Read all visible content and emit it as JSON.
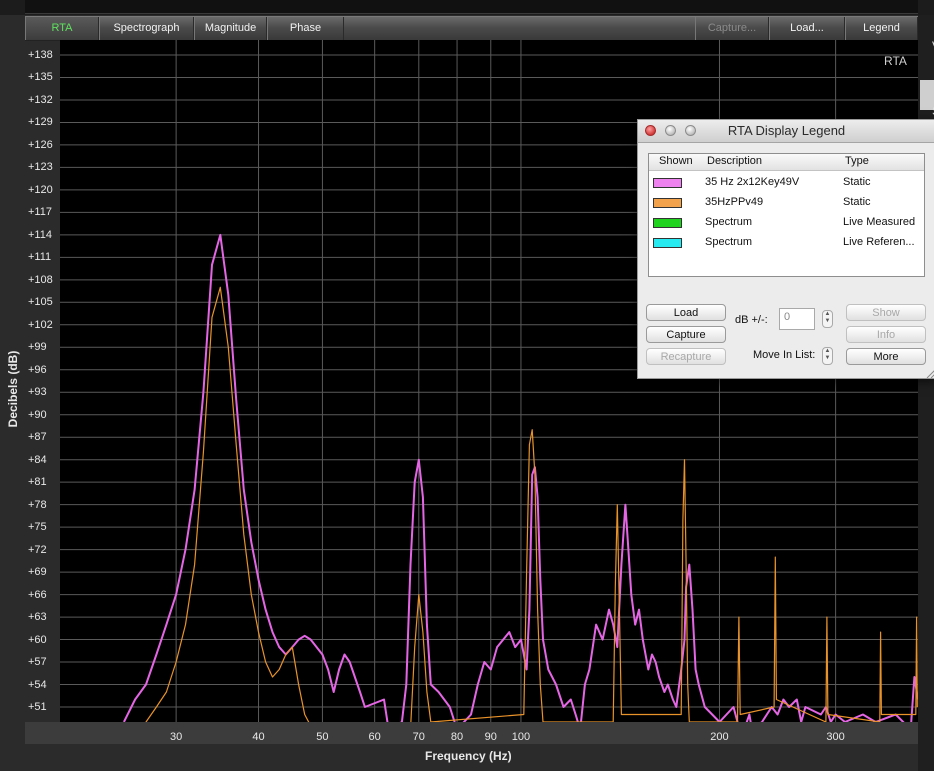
{
  "tabs": [
    {
      "label": "RTA",
      "active": true
    },
    {
      "label": "Spectrograph"
    },
    {
      "label": "Magnitude"
    },
    {
      "label": "Phase"
    },
    {
      "label": "Capture...",
      "disabled": true
    },
    {
      "label": "Load..."
    },
    {
      "label": "Legend"
    }
  ],
  "plot": {
    "name": "RTA",
    "xlabel": "Frequency (Hz)",
    "ylabel": "Decibels (dB)"
  },
  "chart_data": {
    "type": "line",
    "xlabel": "Frequency (Hz)",
    "ylabel": "Decibels (dB)",
    "xscale": "log",
    "xlim": [
      20,
      400
    ],
    "ylim": [
      49,
      140
    ],
    "grid": true,
    "x_ticks": [
      "30",
      "40",
      "50",
      "60",
      "70",
      "80",
      "90",
      "100",
      "200",
      "300"
    ],
    "y_ticks": [
      "+138",
      "+135",
      "+132",
      "+129",
      "+126",
      "+123",
      "+120",
      "+117",
      "+114",
      "+111",
      "+108",
      "+105",
      "+102",
      "+99",
      "+96",
      "+93",
      "+90",
      "+87",
      "+84",
      "+81",
      "+78",
      "+75",
      "+72",
      "+69",
      "+66",
      "+63",
      "+60",
      "+57",
      "+54",
      "+51"
    ],
    "series": [
      {
        "name": "35 Hz 2x12Key49V",
        "color": "#e566e5",
        "points": [
          [
            25,
            49
          ],
          [
            26,
            52
          ],
          [
            27,
            54
          ],
          [
            28,
            58
          ],
          [
            29,
            62
          ],
          [
            30,
            66
          ],
          [
            31,
            72
          ],
          [
            32,
            80
          ],
          [
            33,
            93
          ],
          [
            34,
            110
          ],
          [
            35,
            114
          ],
          [
            36,
            106
          ],
          [
            37,
            92
          ],
          [
            38,
            80
          ],
          [
            39,
            73
          ],
          [
            40,
            68
          ],
          [
            41,
            64
          ],
          [
            42,
            61
          ],
          [
            43,
            59
          ],
          [
            44,
            58
          ],
          [
            45,
            59
          ],
          [
            46,
            60
          ],
          [
            47,
            60.5
          ],
          [
            48,
            60
          ],
          [
            50,
            58
          ],
          [
            51,
            56
          ],
          [
            52,
            53
          ],
          [
            53,
            56
          ],
          [
            54,
            58
          ],
          [
            55,
            57
          ],
          [
            57,
            53
          ],
          [
            58,
            51
          ],
          [
            62,
            52
          ],
          [
            63,
            48
          ],
          [
            66,
            49
          ],
          [
            67,
            54
          ],
          [
            68,
            70
          ],
          [
            69,
            81
          ],
          [
            70,
            84
          ],
          [
            71,
            79
          ],
          [
            72,
            62
          ],
          [
            73,
            54
          ],
          [
            75,
            53
          ],
          [
            78,
            51
          ],
          [
            80,
            48
          ],
          [
            84,
            50
          ],
          [
            86,
            54
          ],
          [
            88,
            57
          ],
          [
            90,
            56
          ],
          [
            92,
            59
          ],
          [
            94,
            60
          ],
          [
            96,
            61
          ],
          [
            98,
            59
          ],
          [
            100,
            60
          ],
          [
            101,
            58
          ],
          [
            102,
            56
          ],
          [
            103,
            64
          ],
          [
            104,
            82
          ],
          [
            105,
            83
          ],
          [
            106,
            79
          ],
          [
            107,
            68
          ],
          [
            108,
            60
          ],
          [
            110,
            56
          ],
          [
            113,
            54
          ],
          [
            116,
            51
          ],
          [
            119,
            52
          ],
          [
            121,
            50
          ],
          [
            123,
            48
          ],
          [
            125,
            54
          ],
          [
            127,
            56
          ],
          [
            130,
            62
          ],
          [
            133,
            60
          ],
          [
            136,
            64
          ],
          [
            138,
            62
          ],
          [
            140,
            59
          ],
          [
            142,
            70
          ],
          [
            144,
            78
          ],
          [
            145,
            74
          ],
          [
            147,
            66
          ],
          [
            149,
            62
          ],
          [
            151,
            64
          ],
          [
            153,
            60
          ],
          [
            156,
            56
          ],
          [
            158,
            58
          ],
          [
            160,
            57
          ],
          [
            162,
            55
          ],
          [
            165,
            53
          ],
          [
            167,
            54
          ],
          [
            170,
            52
          ],
          [
            172,
            51
          ],
          [
            175,
            56
          ],
          [
            177,
            60
          ],
          [
            178,
            67
          ],
          [
            180,
            70
          ],
          [
            182,
            64
          ],
          [
            184,
            56
          ],
          [
            186,
            54
          ],
          [
            190,
            51
          ],
          [
            195,
            50
          ],
          [
            200,
            49
          ],
          [
            210,
            51
          ],
          [
            213,
            49
          ],
          [
            216,
            47
          ],
          [
            222,
            50
          ],
          [
            224,
            48
          ],
          [
            232,
            49
          ],
          [
            240,
            51
          ],
          [
            245,
            50
          ],
          [
            250,
            52
          ],
          [
            255,
            51
          ],
          [
            262,
            52
          ],
          [
            266,
            49
          ],
          [
            270,
            51
          ],
          [
            285,
            50
          ],
          [
            290,
            51
          ],
          [
            295,
            49
          ],
          [
            300,
            50
          ],
          [
            310,
            49
          ],
          [
            330,
            50
          ],
          [
            345,
            49
          ],
          [
            370,
            50
          ],
          [
            390,
            48
          ],
          [
            395,
            55
          ],
          [
            400,
            52
          ]
        ]
      },
      {
        "name": "35HzPPv49",
        "color": "#e8922a",
        "points": [
          [
            25,
            45
          ],
          [
            27,
            49
          ],
          [
            28,
            51
          ],
          [
            29,
            53
          ],
          [
            30,
            57
          ],
          [
            31,
            62
          ],
          [
            32,
            70
          ],
          [
            33,
            85
          ],
          [
            34,
            103
          ],
          [
            35,
            107
          ],
          [
            36,
            99
          ],
          [
            37,
            86
          ],
          [
            38,
            74
          ],
          [
            39,
            66
          ],
          [
            40,
            61
          ],
          [
            41,
            57
          ],
          [
            42,
            55
          ],
          [
            43,
            56
          ],
          [
            44,
            58
          ],
          [
            45,
            59
          ],
          [
            46,
            54
          ],
          [
            47,
            50
          ],
          [
            49,
            47
          ],
          [
            68,
            48
          ],
          [
            69,
            59
          ],
          [
            70,
            66
          ],
          [
            71,
            61
          ],
          [
            72,
            53
          ],
          [
            73,
            49
          ],
          [
            101,
            50
          ],
          [
            102,
            69
          ],
          [
            103,
            86
          ],
          [
            104,
            88
          ],
          [
            105,
            82
          ],
          [
            106,
            64
          ],
          [
            107,
            54
          ],
          [
            108,
            49
          ],
          [
            138,
            49
          ],
          [
            139,
            67
          ],
          [
            140,
            78
          ],
          [
            141,
            64
          ],
          [
            142,
            50
          ],
          [
            175,
            50
          ],
          [
            176,
            76
          ],
          [
            177,
            84
          ],
          [
            178,
            70
          ],
          [
            179,
            54
          ],
          [
            180,
            49
          ],
          [
            213,
            49
          ],
          [
            214,
            63
          ],
          [
            215,
            50
          ],
          [
            242,
            51
          ],
          [
            243,
            71
          ],
          [
            244,
            52
          ],
          [
            290,
            49
          ],
          [
            291,
            63
          ],
          [
            292,
            50
          ],
          [
            350,
            49
          ],
          [
            351,
            61
          ],
          [
            352,
            50
          ],
          [
            397,
            50
          ],
          [
            398,
            63
          ],
          [
            399,
            51
          ]
        ]
      }
    ]
  },
  "legend_window": {
    "title": "RTA Display Legend",
    "columns": [
      "Shown",
      "Description",
      "Type"
    ],
    "rows": [
      {
        "color": "#ee82ee",
        "description": "35 Hz 2x12Key49V",
        "type": "Static"
      },
      {
        "color": "#f2a24a",
        "description": "35HzPPv49",
        "type": "Static"
      },
      {
        "color": "#1fd31f",
        "description": "Spectrum",
        "type": "Live Measured"
      },
      {
        "color": "#26eaf0",
        "description": "Spectrum",
        "type": "Live Referen..."
      }
    ],
    "buttons": {
      "load": "Load",
      "capture": "Capture",
      "recapture": "Recapture",
      "show": "Show",
      "info": "Info",
      "more": "More"
    },
    "db_label": "dB +/-:",
    "db_value": "0",
    "move_label": "Move In List:"
  }
}
